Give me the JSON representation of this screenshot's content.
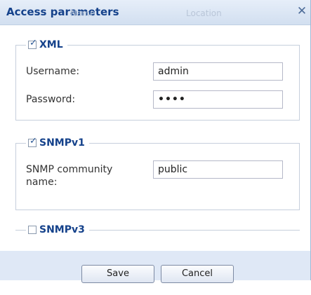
{
  "dialog": {
    "title": "Access parameters",
    "ghost_left": "Name",
    "ghost_right": "Location",
    "close_glyph": "✕"
  },
  "xml": {
    "label": "XML",
    "checked": true,
    "username_label": "Username:",
    "username_value": "admin",
    "password_label": "Password:",
    "password_value": "••••"
  },
  "snmpv1": {
    "label": "SNMPv1",
    "checked": true,
    "community_label_line1": "SNMP community",
    "community_label_line2": "name:",
    "community_value": "public"
  },
  "snmpv3": {
    "label": "SNMPv3",
    "checked": false
  },
  "buttons": {
    "save": "Save",
    "cancel": "Cancel"
  },
  "icons": {
    "checkbox_tick": "✓",
    "close": "close-icon"
  },
  "colors": {
    "title": "#15428b",
    "footer": "#dfe8f6",
    "border": "#c6cfdc"
  }
}
